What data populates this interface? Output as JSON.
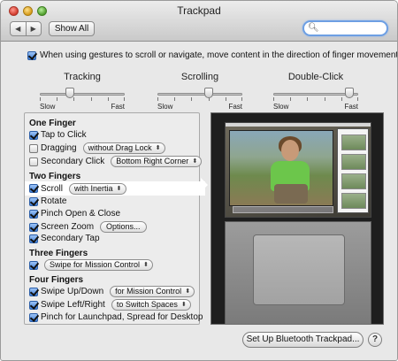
{
  "window": {
    "title": "Trackpad"
  },
  "toolbar": {
    "back_glyph": "◀",
    "forward_glyph": "▶",
    "show_all_label": "Show All",
    "search": {
      "value": "",
      "placeholder": ""
    }
  },
  "scroll_direction": {
    "checked": true,
    "label": "When using gestures to scroll or navigate, move content in the direction of finger movement"
  },
  "sliders": [
    {
      "title": "Tracking",
      "min_label": "Slow",
      "max_label": "Fast",
      "level": 0.35
    },
    {
      "title": "Scrolling",
      "min_label": "Slow",
      "max_label": "Fast",
      "level": 0.6
    },
    {
      "title": "Double-Click",
      "min_label": "Slow",
      "max_label": "Fast",
      "level": 0.9
    }
  ],
  "one_finger": {
    "heading": "One Finger",
    "tap_to_click": {
      "label": "Tap to Click",
      "checked": true
    },
    "dragging": {
      "label": "Dragging",
      "checked": false,
      "popup": "without Drag Lock"
    },
    "secondary_click": {
      "label": "Secondary Click",
      "checked": false,
      "popup": "Bottom Right Corner"
    }
  },
  "two_fingers": {
    "heading": "Two Fingers",
    "scroll": {
      "label": "Scroll",
      "checked": true,
      "popup": "with Inertia",
      "selected": true
    },
    "rotate": {
      "label": "Rotate",
      "checked": true
    },
    "pinch": {
      "label": "Pinch Open & Close",
      "checked": true
    },
    "screen_zoom": {
      "label": "Screen Zoom",
      "checked": true,
      "button": "Options..."
    },
    "secondary_tap": {
      "label": "Secondary Tap",
      "checked": true
    }
  },
  "three_fingers": {
    "heading": "Three Fingers",
    "swipe": {
      "checked": true,
      "popup": "Swipe for Mission Control"
    }
  },
  "four_fingers": {
    "heading": "Four Fingers",
    "swipe_updown": {
      "label": "Swipe Up/Down",
      "checked": true,
      "popup": "for Mission Control"
    },
    "swipe_leftright": {
      "label": "Swipe Left/Right",
      "checked": true,
      "popup": "to Switch Spaces"
    },
    "pinch_launchpad": {
      "label": "Pinch for Launchpad, Spread for Desktop",
      "checked": true
    }
  },
  "footer": {
    "setup_button_label": "Set Up Bluetooth Trackpad...",
    "help_label": "?"
  },
  "icons": {
    "search": "magnifier-icon",
    "popup_arrow": "⬍"
  }
}
